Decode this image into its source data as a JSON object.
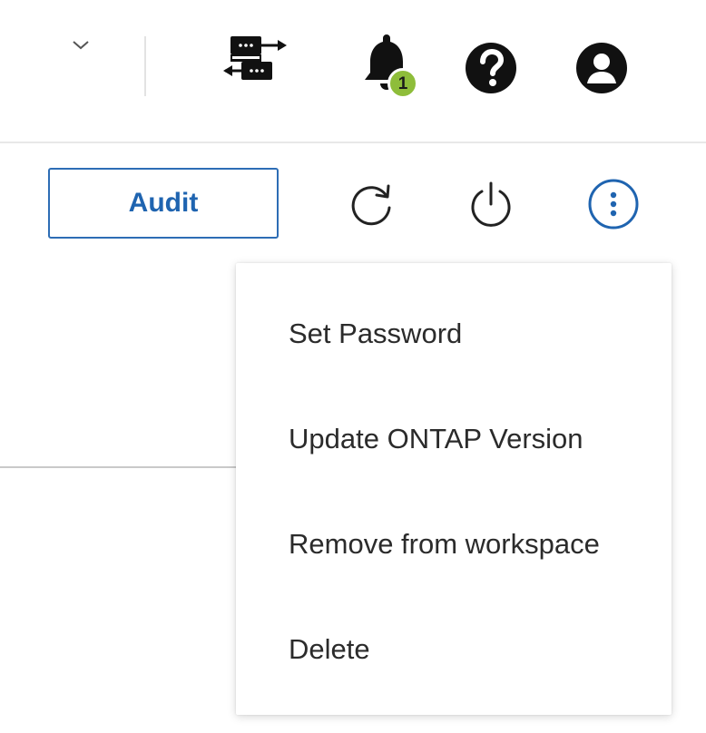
{
  "header": {
    "notifications": {
      "count": "1",
      "badge_color": "#8ebd3a"
    },
    "icons": [
      "chevron-down-icon",
      "transfer-icon",
      "bell-icon",
      "help-icon",
      "user-icon"
    ]
  },
  "toolbar": {
    "audit_label": "Audit",
    "accent_color": "#1f64b0",
    "icons": [
      "refresh-icon",
      "power-icon",
      "more-vertical-icon"
    ]
  },
  "menu": {
    "items": [
      {
        "label": "Set Password"
      },
      {
        "label": "Update ONTAP Version"
      },
      {
        "label": "Remove from workspace"
      },
      {
        "label": "Delete"
      }
    ]
  }
}
